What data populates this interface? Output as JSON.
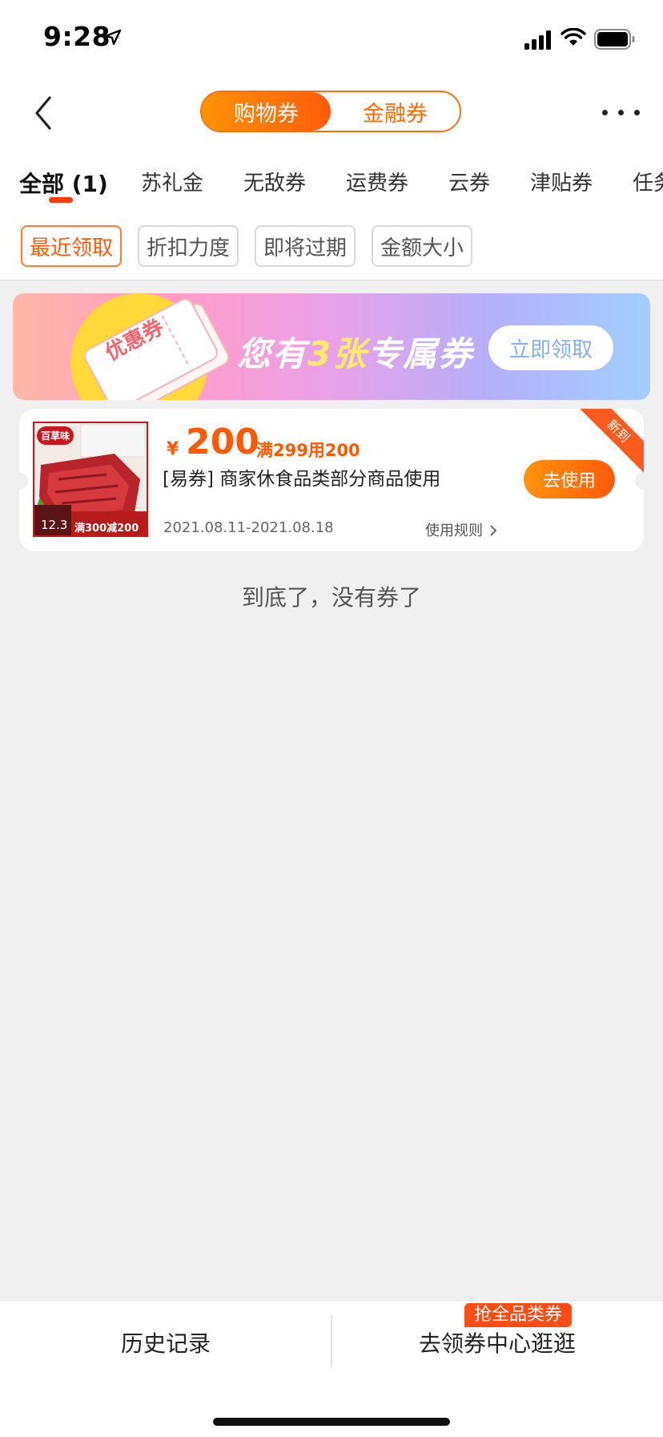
{
  "status_bar": {
    "time": "9:28"
  },
  "nav": {
    "segments": [
      {
        "label": "购物券",
        "active": true
      },
      {
        "label": "金融券",
        "active": false
      }
    ]
  },
  "tabs": [
    {
      "label": "全部 (1)",
      "active": true
    },
    {
      "label": "苏礼金"
    },
    {
      "label": "无敌券"
    },
    {
      "label": "运费券"
    },
    {
      "label": "云券"
    },
    {
      "label": "津贴券"
    },
    {
      "label": "任务"
    }
  ],
  "sort_chips": [
    {
      "label": "最近领取",
      "active": true
    },
    {
      "label": "折扣力度"
    },
    {
      "label": "即将过期"
    },
    {
      "label": "金额大小"
    }
  ],
  "banner": {
    "ticket_label": "优惠券",
    "text_prefix": "您有",
    "count": "3张",
    "text_suffix": "专属券",
    "button": "立即领取"
  },
  "coupon": {
    "ribbon": "新到",
    "currency": "¥",
    "amount": "200",
    "condition": "满299用200",
    "description": "[易券] 商家休食品类部分商品使用",
    "date_range": "2021.08.11-2021.08.18",
    "rules_label": "使用规则",
    "use_button": "去使用",
    "thumb": {
      "brand": "百草味",
      "date": "12.3",
      "promo": "满300减200"
    }
  },
  "end_message": "到底了，没有券了",
  "bottom_bar": {
    "history": "历史记录",
    "coupon_center": "去领券中心逛逛",
    "badge": "抢全品类券"
  },
  "colors": {
    "accent": "#ff6a00",
    "tab_underline": "#ff3d0a",
    "badge": "#ff4b14"
  }
}
